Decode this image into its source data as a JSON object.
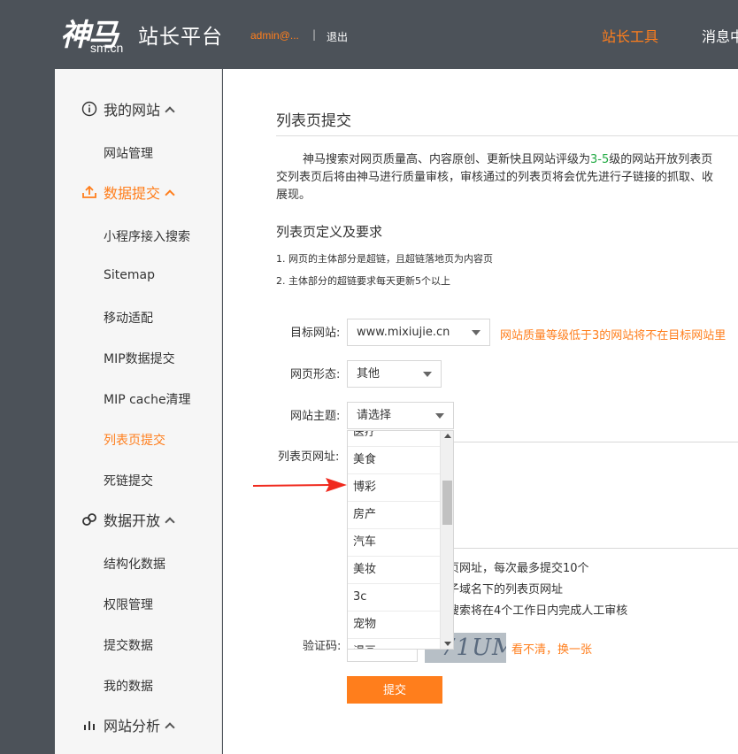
{
  "header": {
    "logo_main": "神马",
    "logo_sub": "sm.cn",
    "logo_title": "站长平台",
    "user": "admin@...",
    "separator": "|",
    "logout": "退出",
    "nav": [
      "站长工具",
      "消息中"
    ]
  },
  "sidebar": {
    "groups": [
      {
        "label": "我的网站",
        "icon": "info-circle-icon",
        "items": [
          "网站管理"
        ]
      },
      {
        "label": "数据提交",
        "icon": "upload-icon",
        "items": [
          "小程序接入搜索",
          "Sitemap",
          "移动适配",
          "MIP数据提交",
          "MIP cache清理",
          "列表页提交",
          "死链提交"
        ]
      },
      {
        "label": "数据开放",
        "icon": "link-icon",
        "items": [
          "结构化数据",
          "权限管理",
          "提交数据",
          "我的数据"
        ]
      },
      {
        "label": "网站分析",
        "icon": "bar-chart-icon",
        "items": []
      }
    ],
    "active_group": "数据提交",
    "active_item": "列表页提交"
  },
  "main": {
    "title": "列表页提交",
    "intro_lines": [
      "神马搜索对网页质量高、内容原创、更新快且网站评级为",
      "3-5",
      "级的网站开放列表页",
      "交列表页后将由神马进行质量审核，审核通过的列表页将会优先进行子链接的抓取、收",
      "展现。"
    ],
    "section_title": "列表页定义及要求",
    "requirements": [
      "1. 网页的主体部分是超链，且超链落地页为内容页",
      "2. 主体部分的超链要求每天更新5个以上"
    ],
    "form": {
      "target_site_label": "目标网站:",
      "target_site_value": "www.mixiujie.cn",
      "target_site_warning": "网站质量等级低于3的网站将不在目标网站里",
      "page_form_label": "网页形态:",
      "page_form_value": "其他",
      "site_theme_label": "网站主题:",
      "site_theme_value": "请选择",
      "url_label": "列表页网址:",
      "notes": [
        "页网址，每次最多提交10个",
        "子域名下的列表页网址",
        "搜索将在4个工作日内完成人工审核"
      ],
      "captcha_label": "验证码:",
      "captcha_chars": "71UM",
      "refresh_text": "看不清，换一张",
      "submit_label": "提交"
    },
    "dropdown_options": [
      "医疗",
      "美食",
      "博彩",
      "房产",
      "汽车",
      "美妆",
      "3c",
      "宠物",
      "漫画"
    ]
  },
  "colors": {
    "accent": "#ff7e1c",
    "header_bg": "#4c5259",
    "highlight": "#22aa44",
    "arrow": "#f02a1e"
  }
}
